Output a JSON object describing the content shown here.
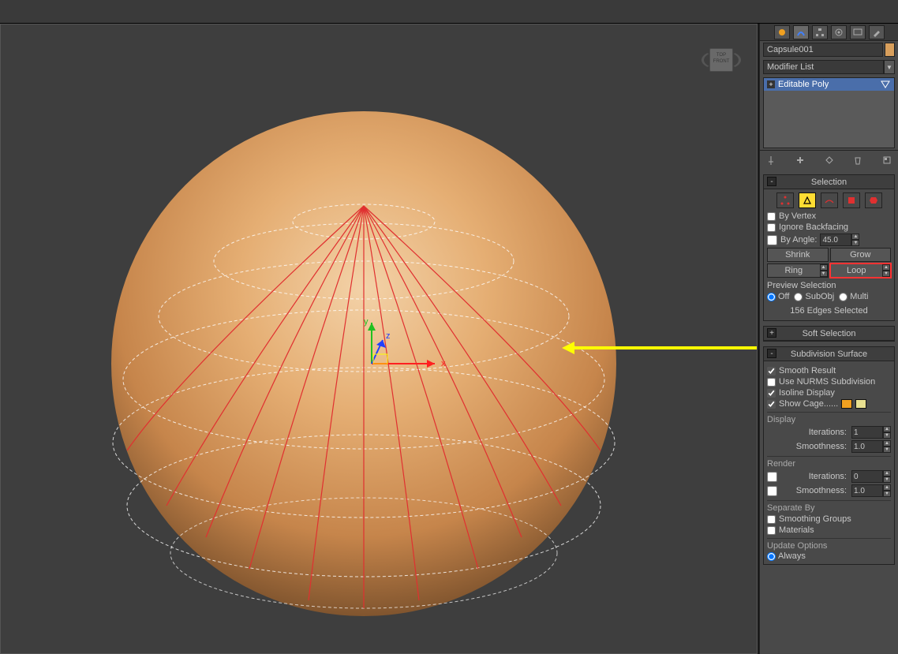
{
  "object_name": "Capsule001",
  "object_color": "#d89f5c",
  "modifier_list_label": "Modifier List",
  "stack": {
    "item0": "Editable Poly"
  },
  "selection": {
    "title": "Selection",
    "by_vertex": "By Vertex",
    "ignore_backfacing": "Ignore Backfacing",
    "by_angle": "By Angle:",
    "angle_value": "45.0",
    "shrink": "Shrink",
    "grow": "Grow",
    "ring": "Ring",
    "loop": "Loop",
    "preview_label": "Preview Selection",
    "off": "Off",
    "subobj": "SubObj",
    "multi": "Multi",
    "info": "156 Edges Selected"
  },
  "soft_selection": {
    "title": "Soft Selection"
  },
  "subdiv": {
    "title": "Subdivision Surface",
    "smooth_result": "Smooth Result",
    "use_nurms": "Use NURMS Subdivision",
    "isoline": "Isoline Display",
    "show_cage": "Show Cage",
    "display": "Display",
    "iterations": "Iterations:",
    "iterations_val": "1",
    "smoothness": "Smoothness:",
    "smoothness_val": "1.0",
    "render": "Render",
    "r_iterations_val": "0",
    "r_smoothness_val": "1.0",
    "separate_by": "Separate By",
    "smoothing_groups": "Smoothing Groups",
    "materials": "Materials",
    "update_options": "Update Options",
    "always": "Always"
  },
  "cage_color1": "#f0a020",
  "cage_color2": "#e8e090"
}
